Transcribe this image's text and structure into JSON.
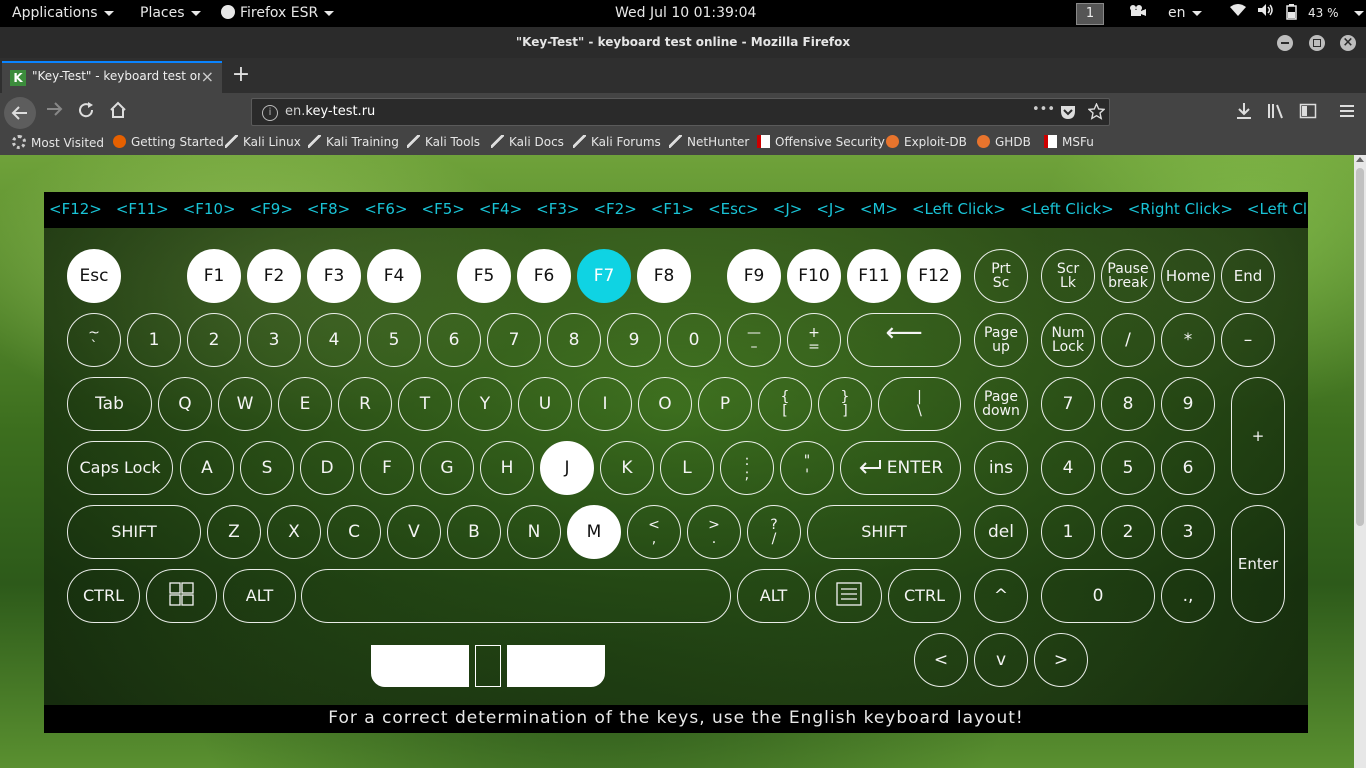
{
  "topbar": {
    "applications": "Applications",
    "places": "Places",
    "firefox": "Firefox ESR",
    "clock": "Wed Jul 10  01:39:04",
    "workspace": "1",
    "language": "en",
    "battery": "43 %"
  },
  "window": {
    "title": "\"Key-Test\" - keyboard test online - Mozilla Firefox"
  },
  "tab": {
    "favicon": "K",
    "title": "\"Key-Test\" - keyboard test online",
    "close": "×",
    "new": "+"
  },
  "url": {
    "prefix": "en.",
    "domain": "key-test.ru",
    "more": "•••"
  },
  "bookmarks": [
    "Most Visited",
    "Getting Started",
    "Kali Linux",
    "Kali Training",
    "Kali Tools",
    "Kali Docs",
    "Kali Forums",
    "NetHunter",
    "Offensive Security",
    "Exploit-DB",
    "GHDB",
    "MSFu"
  ],
  "log": [
    "<F12>",
    "<F11>",
    "<F10>",
    "<F9>",
    "<F8>",
    "<F6>",
    "<F5>",
    "<F4>",
    "<F3>",
    "<F2>",
    "<F1>",
    "<Esc>",
    "<J>",
    "<J>",
    "<M>",
    "<Left Click>",
    "<Left Click>",
    "<Right Click>",
    "<Left Click>"
  ],
  "keys": {
    "esc": "Esc",
    "f1": "F1",
    "f2": "F2",
    "f3": "F3",
    "f4": "F4",
    "f5": "F5",
    "f6": "F6",
    "f7": "F7",
    "f8": "F8",
    "f9": "F9",
    "f10": "F10",
    "f11": "F11",
    "f12": "F12",
    "prtsc_1": "Prt",
    "prtsc_2": "Sc",
    "scrlk_1": "Scr",
    "scrlk_2": "Lk",
    "pause_1": "Pause",
    "pause_2": "break",
    "home": "Home",
    "end": "End",
    "tilde_1": "~",
    "tilde_2": "`",
    "d1": "1",
    "d2": "2",
    "d3": "3",
    "d4": "4",
    "d5": "5",
    "d6": "6",
    "d7": "7",
    "d8": "8",
    "d9": "9",
    "d0": "0",
    "minus_1": "—",
    "minus_2": "–",
    "plus_1": "+",
    "plus_2": "=",
    "backspace": "⟵",
    "pageup_1": "Page",
    "pageup_2": "up",
    "numlock_1": "Num",
    "numlock_2": "Lock",
    "slash": "/",
    "star": "*",
    "dash": "–",
    "tab": "Tab",
    "q": "Q",
    "w": "W",
    "e": "E",
    "r": "R",
    "t": "T",
    "y": "Y",
    "u": "U",
    "i": "I",
    "o": "O",
    "p": "P",
    "lbrace_1": "{",
    "lbrace_2": "[",
    "rbrace_1": "}",
    "rbrace_2": "]",
    "pipe_1": "|",
    "pipe_2": "\\",
    "pagedown_1": "Page",
    "pagedown_2": "down",
    "n7": "7",
    "n8": "8",
    "n9": "9",
    "nplus": "+",
    "caps": "Caps Lock",
    "a": "A",
    "s": "S",
    "d": "D",
    "f": "F",
    "g": "G",
    "h": "H",
    "j": "J",
    "k": "K",
    "l": "L",
    "semi_1": ":",
    "semi_2": ";",
    "quote_1": "\"",
    "quote_2": "'",
    "enter": "ENTER",
    "ins": "ins",
    "n4": "4",
    "n5": "5",
    "n6": "6",
    "lshift": "SHIFT",
    "z": "Z",
    "x": "X",
    "c": "C",
    "v": "V",
    "b": "B",
    "n": "N",
    "m": "M",
    "lt_1": "<",
    "lt_2": ",",
    "gt_1": ">",
    "gt_2": ".",
    "q_1": "?",
    "q_2": "/",
    "rshift": "SHIFT",
    "del": "del",
    "n1": "1",
    "n2": "2",
    "n3": "3",
    "nenter": "Enter",
    "lctrl": "CTRL",
    "lalt": "ALT",
    "ralt": "ALT",
    "rctrl": "CTRL",
    "up": "^",
    "n0": "0",
    "ndot": ".,",
    "left": "<",
    "down": "v",
    "right": ">"
  },
  "footer": "For a correct determination of the keys, use the English keyboard layout!",
  "colors": {
    "active_key": "#0fd3e3",
    "log_text": "#19c3d6"
  }
}
